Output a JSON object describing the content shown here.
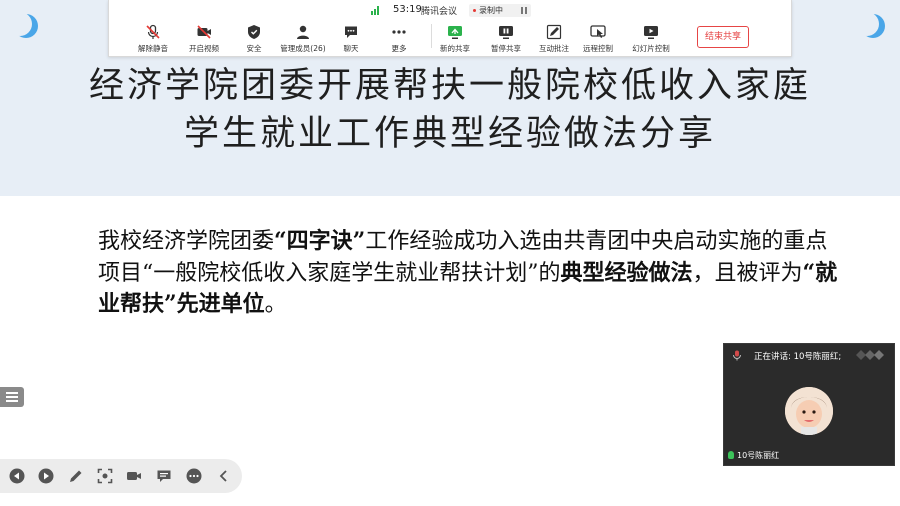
{
  "toolbar": {
    "timer": "53:19",
    "app_name": "腾讯会议",
    "recording_label": "录制中",
    "buttons": {
      "unmute": "解除静音",
      "start_video": "开启视频",
      "security": "安全",
      "manage_members": "管理成员(26)",
      "chat": "聊天",
      "more": "更多",
      "new_share": "新的共享",
      "pause_share": "暂停共享",
      "annotate": "互动批注",
      "remote_control": "远程控制",
      "slide_control": "幻灯片控制"
    },
    "end_share": "结束共享"
  },
  "slide": {
    "title_line1": "经济学院团委开展帮扶一般院校低收入家庭",
    "title_line2": "学生就业工作典型经验做法分享",
    "body": {
      "t1": "我校经济学院团委",
      "b1": "“四字诀”",
      "t2": "工作经验成功入选由共青团中央启动实施的重点项目“一般院校低收入家庭学生就业帮扶计划”的",
      "b2": "典型经验做法",
      "t3": "，且被评为",
      "b3": "“就业帮扶”先进单位",
      "t4": "。"
    }
  },
  "video": {
    "speaking_label": "正在讲话: 10号陈丽红;",
    "participant_name": "10号陈丽红"
  },
  "colors": {
    "accent_blue": "#4aa6e8",
    "end_share_red": "#e64545",
    "signal_green": "#2bb24c"
  }
}
